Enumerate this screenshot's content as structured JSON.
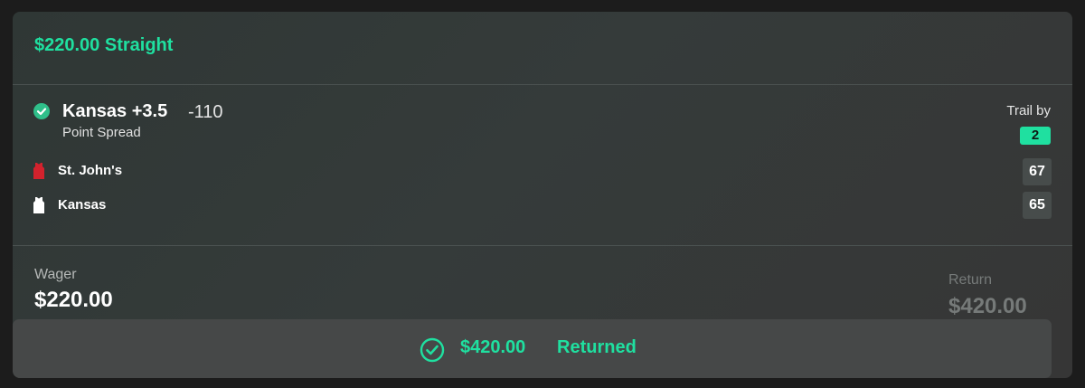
{
  "bet": {
    "title": "$220.00 Straight",
    "pick": "Kansas +3.5",
    "odds": "-110",
    "market": "Point Spread",
    "trail_label": "Trail by",
    "trail_value": "2"
  },
  "teams": [
    {
      "name": "St. John's",
      "score": "67",
      "jersey_color": "#d3222d",
      "icon": "jersey-icon"
    },
    {
      "name": "Kansas",
      "score": "65",
      "jersey_color": "#ffffff",
      "icon": "jersey-icon"
    }
  ],
  "wager": {
    "label": "Wager",
    "amount": "$220.00"
  },
  "return": {
    "label": "Return",
    "amount": "$420.00"
  },
  "settled": {
    "amount": "$420.00",
    "status": "Returned",
    "icon": "check-circle-icon"
  },
  "colors": {
    "accent": "#1fe0a0",
    "win_check": "#2fbf8a"
  }
}
